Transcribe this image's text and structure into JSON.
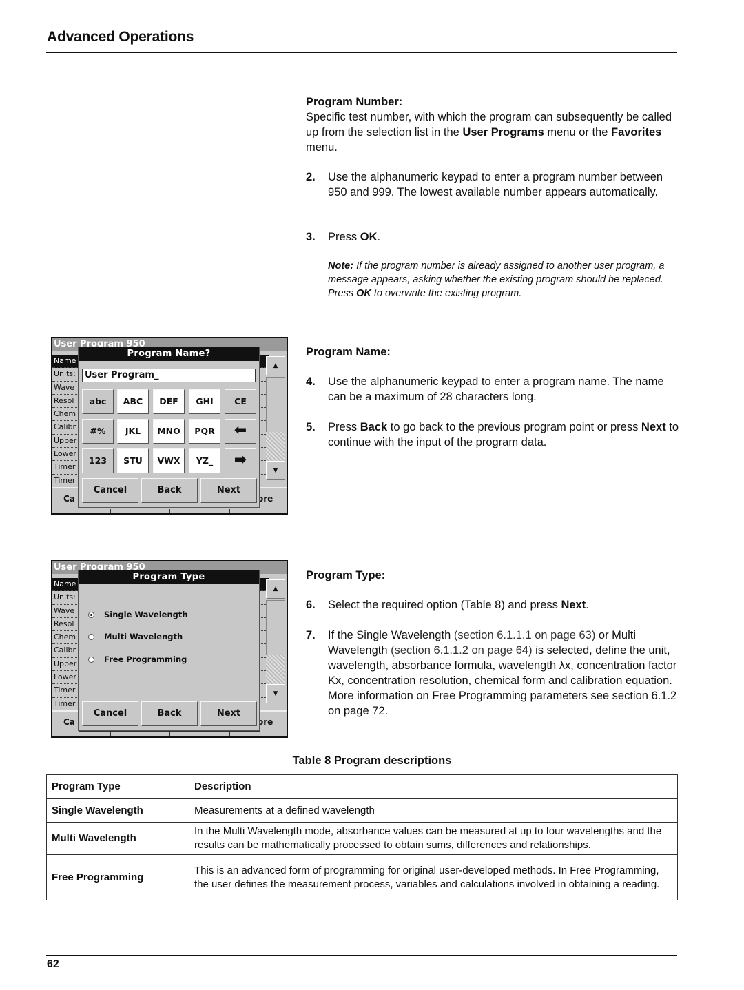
{
  "header": {
    "title": "Advanced Operations"
  },
  "footer": {
    "page_number": "62"
  },
  "program_number": {
    "heading": "Program Number:",
    "intro_parts": [
      "Specific test number, with which the program can subsequently be called up from the selection list in the ",
      "User Programs",
      " menu or the ",
      "Favorites",
      " menu."
    ],
    "step2": {
      "num": "2.",
      "text": "Use the alphanumeric keypad to enter a program number between 950 and 999. The lowest available number appears automatically."
    },
    "step3": {
      "num": "3.",
      "text_parts": [
        "Press ",
        "OK",
        "."
      ]
    },
    "note": {
      "label": "Note:",
      "parts": [
        " If the program number is already assigned to another user program, a message appears, asking whether the existing program should be replaced. Press ",
        "OK",
        " to overwrite the existing program."
      ]
    }
  },
  "program_name": {
    "heading": "Program Name:",
    "step4": {
      "num": "4.",
      "text": "Use the alphanumeric keypad to enter a program name. The name can be a maximum of 28 characters long."
    },
    "step5": {
      "num": "5.",
      "parts": [
        "Press ",
        "Back",
        " to go back to the previous program point or press ",
        "Next",
        " to continue with the input of the program data."
      ]
    }
  },
  "program_type": {
    "heading": "Program Type:",
    "step6": {
      "num": "6.",
      "parts": [
        "Select the required option (Table 8) and press ",
        "Next",
        "."
      ]
    },
    "step7": {
      "num": "7.",
      "parts": [
        "If the Single Wavelength ",
        "(section 6.1.1.1 on page 63)",
        " or Multi Wavelength ",
        "(section 6.1.1.2 on page 64)",
        " is selected, define the unit, wavelength, absorbance formula, wavelength λx, concentration factor Kx, concentration resolution, chemical form and calibration equation."
      ],
      "more": "More information on Free Programming parameters see section 6.1.2 on page 72."
    }
  },
  "screen_common": {
    "title": "User Program   950",
    "list_rows": [
      "Name",
      "Units:",
      "Wave",
      "Resol",
      "Chem",
      "Calibr",
      "Upper",
      "Lower",
      "Timer",
      "Timer"
    ],
    "bottom_left": "Ca",
    "bottom_right": "ore",
    "scroll_up": "▲",
    "scroll_down": "▼"
  },
  "screen_name": {
    "dialog_title": "Program Name?",
    "input_value": "User Program_",
    "keys": [
      [
        "abc",
        "ABC",
        "DEF",
        "GHI",
        "CE"
      ],
      [
        "#%",
        "JKL",
        "MNO",
        "PQR",
        "⬅"
      ],
      [
        "123",
        "STU",
        "VWX",
        "YZ_",
        "➡"
      ]
    ],
    "buttons": [
      "Cancel",
      "Back",
      "Next"
    ]
  },
  "screen_type": {
    "dialog_title": "Program Type",
    "options": [
      {
        "label": "Single Wavelength",
        "selected": true
      },
      {
        "label": "Multi Wavelength",
        "selected": false
      },
      {
        "label": "Free Programming",
        "selected": false
      }
    ],
    "buttons": [
      "Cancel",
      "Back",
      "Next"
    ]
  },
  "table": {
    "caption": "Table 8  Program descriptions",
    "headers": [
      "Program Type",
      "Description"
    ],
    "rows": [
      [
        "Single Wavelength",
        "Measurements at a defined wavelength"
      ],
      [
        "Multi Wavelength",
        "In the Multi Wavelength mode, absorbance values can be measured at up to four wavelengths and the results can be mathematically processed to obtain sums, differences and relationships."
      ],
      [
        "Free Programming",
        "This is an advanced form of programming for original user-developed methods. In Free Programming, the user defines the measurement process, variables and calculations involved in obtaining a reading."
      ]
    ]
  }
}
